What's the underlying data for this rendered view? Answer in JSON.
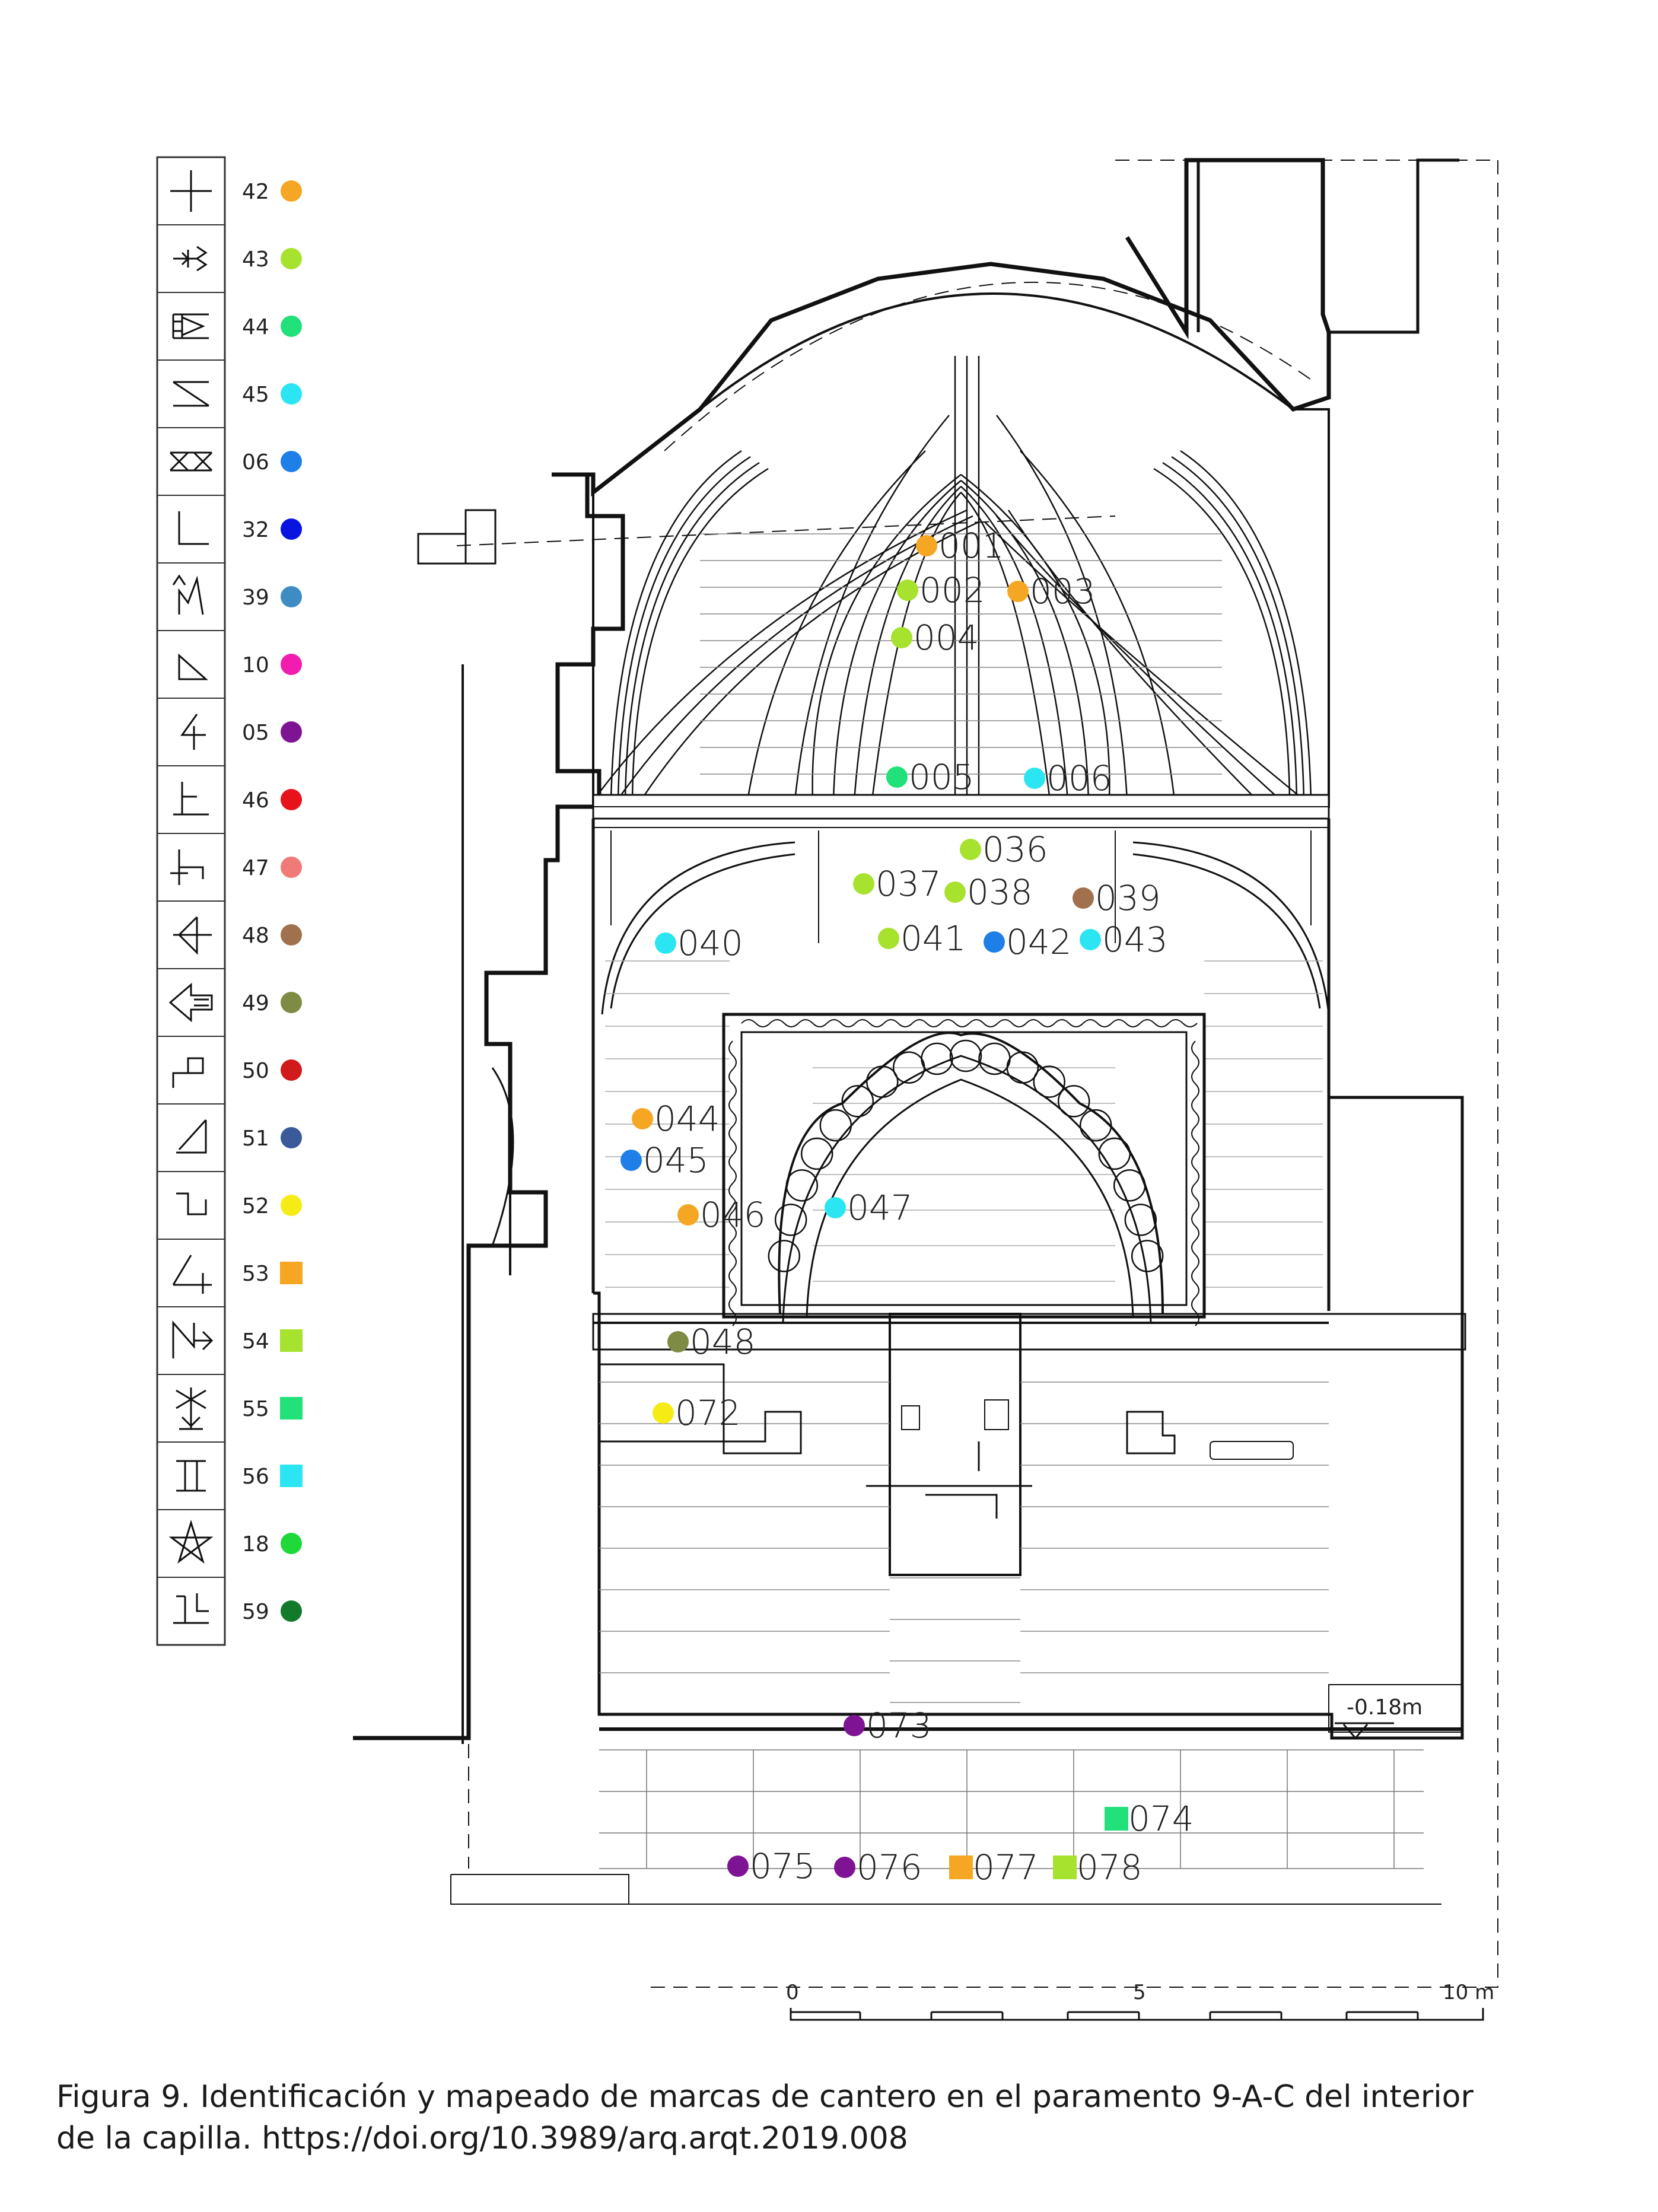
{
  "legend": [
    {
      "code": "42",
      "color": "#F5A623",
      "shape": "circle",
      "glyph": "cross-mark"
    },
    {
      "code": "43",
      "color": "#A6E22E",
      "shape": "circle",
      "glyph": "arrow-zigzag-mark"
    },
    {
      "code": "44",
      "color": "#22E07A",
      "shape": "circle",
      "glyph": "ladder-flag-mark"
    },
    {
      "code": "45",
      "color": "#2BE6F2",
      "shape": "circle",
      "glyph": "z-bars-mark"
    },
    {
      "code": "06",
      "color": "#1E7FE8",
      "shape": "circle",
      "glyph": "double-x-mark"
    },
    {
      "code": "32",
      "color": "#0A14E0",
      "shape": "circle",
      "glyph": "right-angle-mark"
    },
    {
      "code": "39",
      "color": "#3F8CC4",
      "shape": "circle",
      "glyph": "arrow-m-mark"
    },
    {
      "code": "10",
      "color": "#F21DB0",
      "shape": "circle",
      "glyph": "triangle-mark"
    },
    {
      "code": "05",
      "color": "#7E1494",
      "shape": "circle",
      "glyph": "four-mark"
    },
    {
      "code": "46",
      "color": "#E8131A",
      "shape": "circle",
      "glyph": "hook-t-mark"
    },
    {
      "code": "47",
      "color": "#F07A78",
      "shape": "circle",
      "glyph": "h-hook-mark"
    },
    {
      "code": "48",
      "color": "#A0714C",
      "shape": "circle",
      "glyph": "bow-arrow-mark"
    },
    {
      "code": "49",
      "color": "#7E8B45",
      "shape": "circle",
      "glyph": "big-arrow-mark"
    },
    {
      "code": "50",
      "color": "#D11A1C",
      "shape": "circle",
      "glyph": "step-flag-mark"
    },
    {
      "code": "51",
      "color": "#3A5A9A",
      "shape": "circle",
      "glyph": "slash-corner-mark"
    },
    {
      "code": "52",
      "color": "#F5EC16",
      "shape": "circle",
      "glyph": "step-hook-mark"
    },
    {
      "code": "53",
      "color": "#F5A623",
      "shape": "square",
      "glyph": "angle-cross-mark"
    },
    {
      "code": "54",
      "color": "#A6E22E",
      "shape": "square",
      "glyph": "n-arrow-mark"
    },
    {
      "code": "55",
      "color": "#22E07A",
      "shape": "square",
      "glyph": "arrow-x-mark"
    },
    {
      "code": "56",
      "color": "#2BE6F2",
      "shape": "square",
      "glyph": "i-beam-mark"
    },
    {
      "code": "18",
      "color": "#1FD83A",
      "shape": "circle",
      "glyph": "pentagram-mark"
    },
    {
      "code": "59",
      "color": "#127A2A",
      "shape": "circle",
      "glyph": "double-hook-mark"
    }
  ],
  "marks": [
    {
      "id": "001",
      "code": "42"
    },
    {
      "id": "002",
      "code": "43"
    },
    {
      "id": "003",
      "code": "42"
    },
    {
      "id": "004",
      "code": "43"
    },
    {
      "id": "005",
      "code": "44"
    },
    {
      "id": "006",
      "code": "45"
    },
    {
      "id": "036",
      "code": "43"
    },
    {
      "id": "037",
      "code": "43"
    },
    {
      "id": "038",
      "code": "43"
    },
    {
      "id": "039",
      "code": "48"
    },
    {
      "id": "040",
      "code": "45"
    },
    {
      "id": "041",
      "code": "43"
    },
    {
      "id": "042",
      "code": "06"
    },
    {
      "id": "043",
      "code": "45"
    },
    {
      "id": "044",
      "code": "42"
    },
    {
      "id": "045",
      "code": "06"
    },
    {
      "id": "046",
      "code": "42"
    },
    {
      "id": "047",
      "code": "45"
    },
    {
      "id": "048",
      "code": "49"
    },
    {
      "id": "072",
      "code": "52"
    },
    {
      "id": "073",
      "code": "05"
    },
    {
      "id": "074",
      "code": "55"
    },
    {
      "id": "075",
      "code": "05"
    },
    {
      "id": "076",
      "code": "05"
    },
    {
      "id": "077",
      "code": "53"
    },
    {
      "id": "078",
      "code": "54"
    }
  ],
  "level": "-0.18m",
  "scale": {
    "labels": [
      "0",
      "5",
      "10 m"
    ]
  },
  "caption": {
    "line1": "Figura 9. Identificación y mapeado de marcas de cantero en el paramento 9-A-C del interior",
    "line2": "de la capilla. https://doi.org/10.3989/arq.arqt.2019.008"
  }
}
